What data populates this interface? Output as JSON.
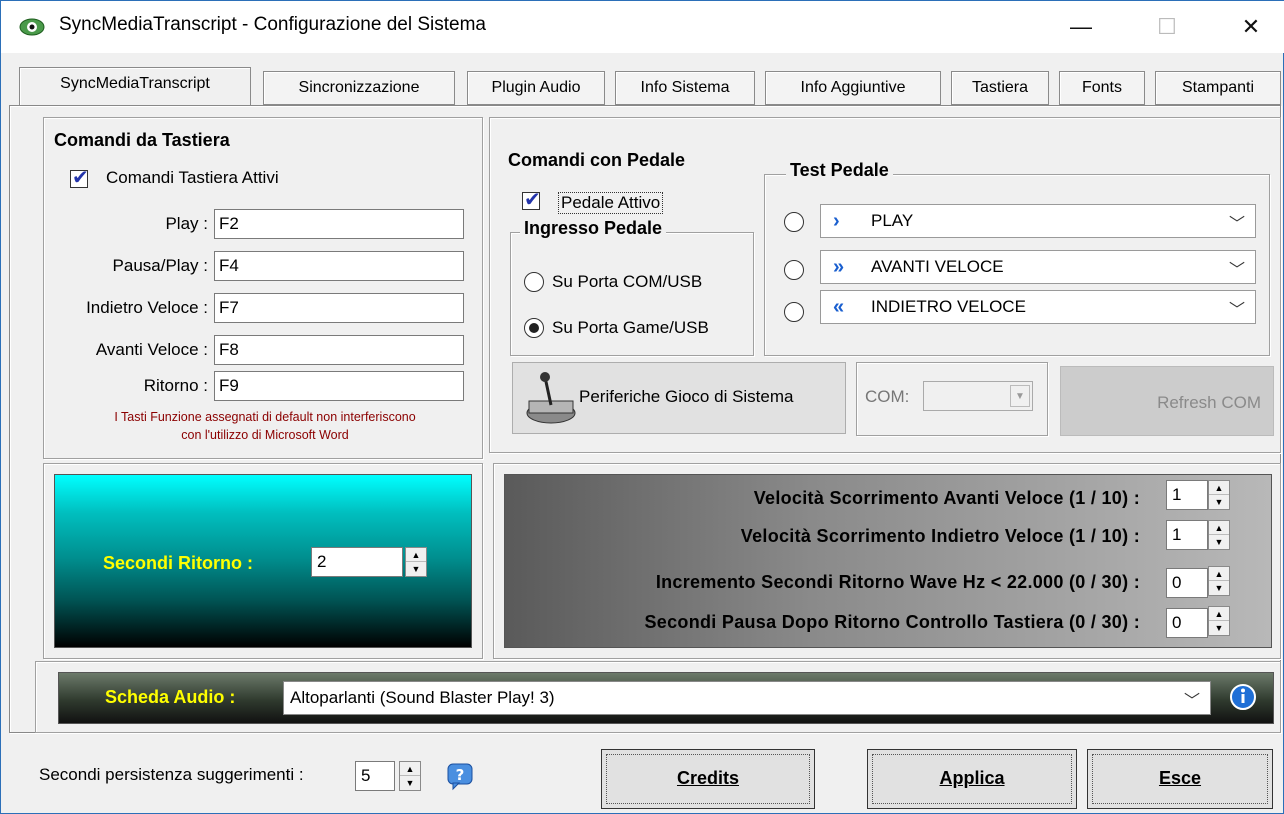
{
  "window": {
    "title": "SyncMediaTranscript - Configurazione del Sistema",
    "minimize": "—",
    "maximize": "☐",
    "close": "✕"
  },
  "tabs": [
    {
      "label": "SyncMediaTranscript",
      "active": true
    },
    {
      "label": "Sincronizzazione",
      "active": false
    },
    {
      "label": "Plugin Audio",
      "active": false
    },
    {
      "label": "Info Sistema",
      "active": false
    },
    {
      "label": "Info Aggiuntive",
      "active": false
    },
    {
      "label": "Tastiera",
      "active": false
    },
    {
      "label": "Fonts",
      "active": false
    },
    {
      "label": "Stampanti",
      "active": false
    }
  ],
  "keyboard": {
    "title": "Comandi da Tastiera",
    "enabled_label": "Comandi Tastiera Attivi",
    "enabled": true,
    "fields": [
      {
        "label": "Play :",
        "value": "F2"
      },
      {
        "label": "Pausa/Play :",
        "value": "F4"
      },
      {
        "label": "Indietro Veloce :",
        "value": "F7"
      },
      {
        "label": "Avanti Veloce :",
        "value": "F8"
      },
      {
        "label": "Ritorno :",
        "value": "F9"
      }
    ],
    "note_line1": "I Tasti Funzione assegnati di default non interferiscono",
    "note_line2": "con l'utilizzo di Microsoft Word",
    "note_color": "#8b0000"
  },
  "pedal": {
    "title": "Comandi con Pedale",
    "enabled_label": "Pedale Attivo",
    "enabled": true,
    "input_group": "Ingresso Pedale",
    "input_options": [
      {
        "label": "Su Porta COM/USB",
        "selected": false
      },
      {
        "label": "Su Porta Game/USB",
        "selected": true
      }
    ],
    "test_group": "Test Pedale",
    "test_items": [
      {
        "icon": "chevron-right-icon",
        "label": "PLAY"
      },
      {
        "icon": "double-chevron-right-icon",
        "label": "AVANTI VELOCE"
      },
      {
        "icon": "double-chevron-left-icon",
        "label": "INDIETRO VELOCE"
      }
    ],
    "game_devices_button": "Periferiche Gioco di Sistema",
    "com_label": "COM:",
    "com_value": "",
    "refresh_button": "Refresh COM"
  },
  "return_seconds": {
    "label": "Secondi Ritorno :",
    "value": "2"
  },
  "speed": {
    "rows": [
      {
        "label": "Velocità Scorrimento Avanti Veloce  (1 / 10) :",
        "value": "1"
      },
      {
        "label": "Velocità Scorrimento Indietro Veloce  (1 / 10) :",
        "value": "1"
      },
      {
        "label": "Incremento Secondi Ritorno Wave Hz < 22.000  (0 / 30) :",
        "value": "0"
      },
      {
        "label": "Secondi Pausa Dopo Ritorno Controllo Tastiera  (0 / 30) :",
        "value": "0"
      }
    ]
  },
  "audio": {
    "label": "Scheda Audio :",
    "value": "Altoparlanti (Sound Blaster Play! 3)",
    "accent": "#ffff00"
  },
  "footer": {
    "persist_label": "Secondi persistenza suggerimenti :",
    "persist_value": "5",
    "credits": "Credits",
    "apply": "Applica",
    "exit": "Esce"
  }
}
